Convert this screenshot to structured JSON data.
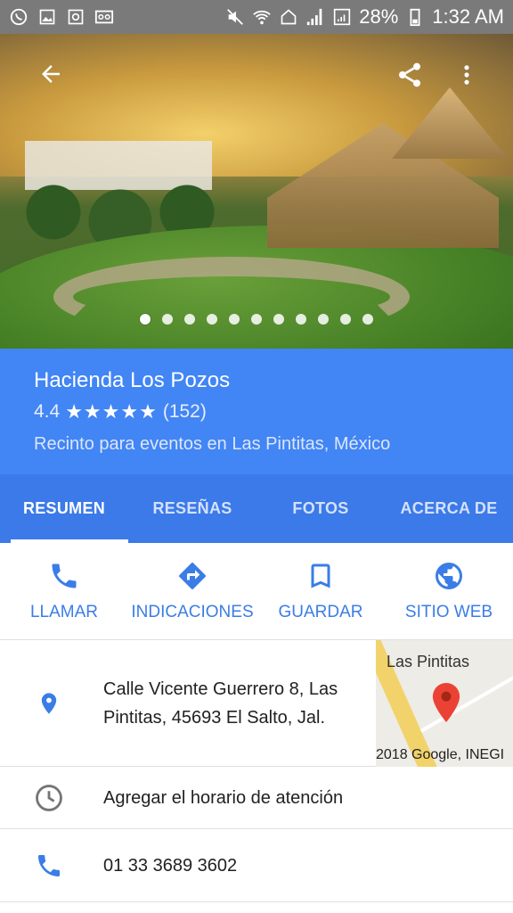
{
  "status_bar": {
    "battery": "28%",
    "time": "1:32 AM"
  },
  "place": {
    "name": "Hacienda Los Pozos",
    "rating": "4.4",
    "stars": "★★★★★",
    "reviews_count": "(152)",
    "category_location": "Recinto para eventos en Las Pintitas, México",
    "photo_count": 11,
    "active_photo_index": 0
  },
  "tabs": [
    {
      "label": "RESUMEN",
      "active": true
    },
    {
      "label": "RESEÑAS",
      "active": false
    },
    {
      "label": "FOTOS",
      "active": false
    },
    {
      "label": "ACERCA DE",
      "active": false
    }
  ],
  "actions": [
    {
      "label": "LLAMAR",
      "icon": "phone-icon"
    },
    {
      "label": "INDICACIONES",
      "icon": "directions-icon"
    },
    {
      "label": "GUARDAR",
      "icon": "bookmark-icon"
    },
    {
      "label": "SITIO WEB",
      "icon": "globe-icon"
    }
  ],
  "address": {
    "line1": "Calle Vicente Guerrero 8, Las",
    "line2": "Pintitas, 45693 El Salto, Jal."
  },
  "map": {
    "label": "Las Pintitas",
    "copyright": "2018 Google, INEGI"
  },
  "hours": {
    "text": "Agregar el horario de atención"
  },
  "phone": {
    "number": "01 33 3689 3602"
  },
  "colors": {
    "header_blue": "#4285f4",
    "tab_blue": "#3b7ae8",
    "accent_blue": "#3a7de6",
    "pin_red": "#ea4335"
  }
}
